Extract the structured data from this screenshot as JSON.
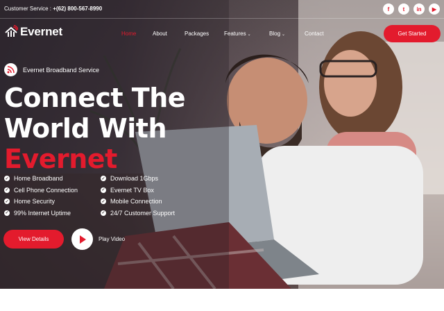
{
  "topbar": {
    "service_label": "Customer Service :",
    "phone": "+(62) 800-567-8990",
    "social": [
      {
        "icon": "facebook-icon",
        "glyph": "f"
      },
      {
        "icon": "twitter-icon",
        "glyph": "t"
      },
      {
        "icon": "linkedin-icon",
        "glyph": "in"
      },
      {
        "icon": "youtube-icon",
        "glyph": "▶"
      }
    ]
  },
  "logo": {
    "name": "Evernet",
    "icon": "house-wifi-icon"
  },
  "nav": {
    "items": [
      {
        "label": "Home",
        "active": true
      },
      {
        "label": "About"
      },
      {
        "label": "Packages"
      },
      {
        "label": "Features",
        "dropdown": true
      },
      {
        "label": "Blog",
        "dropdown": true
      },
      {
        "label": "Contact"
      }
    ],
    "cta": "Get Started"
  },
  "hero": {
    "tag": "Evernet Broadband Service",
    "tag_icon": "rss-icon",
    "headline_1": "Connect The",
    "headline_2": "World With",
    "headline_3": "Evernet",
    "features_left": [
      "Home Broadband",
      "Cell Phone Connection",
      "Home Security",
      "99% Internet Uptime"
    ],
    "features_right": [
      "Download 1Gbps",
      "Evernet TV Box",
      "Mobile Connection",
      "24/7 Customer Support"
    ],
    "view_details": "View Details",
    "play_video": "Play Video"
  },
  "colors": {
    "accent": "#e31b2d",
    "text": "#ffffff"
  }
}
